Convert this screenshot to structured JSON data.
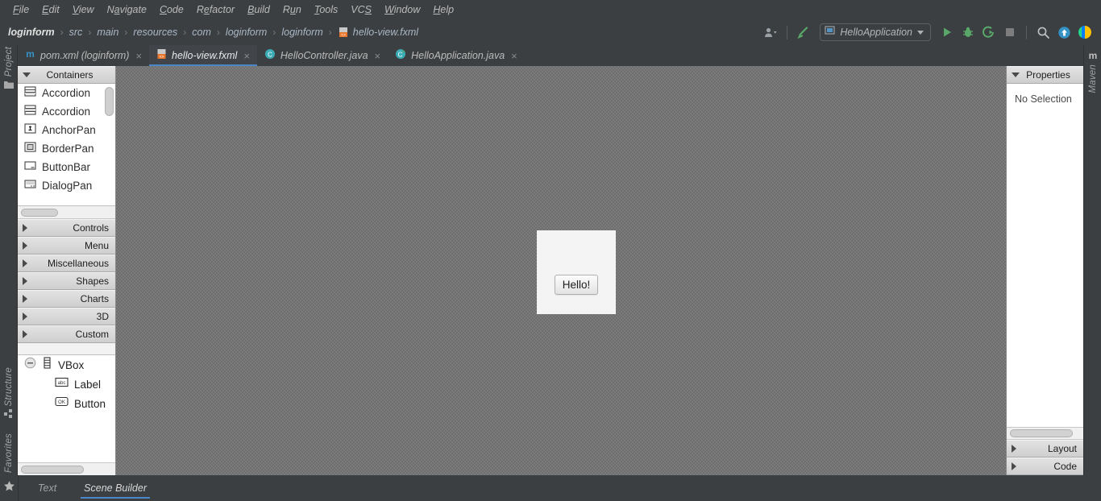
{
  "menu": {
    "items": [
      {
        "label": "File",
        "mnemonic": "F"
      },
      {
        "label": "Edit",
        "mnemonic": "E"
      },
      {
        "label": "View",
        "mnemonic": "V"
      },
      {
        "label": "Navigate",
        "mnemonic": "N"
      },
      {
        "label": "Code",
        "mnemonic": "C"
      },
      {
        "label": "Refactor",
        "mnemonic": "R"
      },
      {
        "label": "Build",
        "mnemonic": "B"
      },
      {
        "label": "Run",
        "mnemonic": "u"
      },
      {
        "label": "Tools",
        "mnemonic": "T"
      },
      {
        "label": "VCS",
        "mnemonic": "S"
      },
      {
        "label": "Window",
        "mnemonic": "W"
      },
      {
        "label": "Help",
        "mnemonic": "H"
      }
    ]
  },
  "breadcrumb": {
    "items": [
      {
        "label": "loginform"
      },
      {
        "label": "src"
      },
      {
        "label": "main"
      },
      {
        "label": "resources"
      },
      {
        "label": "com"
      },
      {
        "label": "loginform"
      },
      {
        "label": "loginform"
      },
      {
        "label": "hello-view.fxml",
        "icon": "fxml-file-icon"
      }
    ],
    "separator": "›"
  },
  "toolbar": {
    "account_icon": "user-account-icon",
    "build_icon": "build-hammer-icon",
    "run_config": {
      "icon": "application-config-icon",
      "label": "HelloApplication",
      "dropdown_icon": "chevron-down-icon"
    },
    "run_icon": "run-play-icon",
    "debug_icon": "debug-bug-icon",
    "run_coverage_icon": "run-with-coverage-icon",
    "stop_icon": "stop-square-icon",
    "search_icon": "search-icon",
    "update_icon": "update-arrow-icon",
    "ide_icon": "intellij-logo-icon"
  },
  "editor_tabs": {
    "close_glyph": "×",
    "tabs": [
      {
        "label": "pom.xml (loginform)",
        "icon": "maven-pom-icon",
        "active": false
      },
      {
        "label": "hello-view.fxml",
        "icon": "fxml-file-icon",
        "active": true
      },
      {
        "label": "HelloController.java",
        "icon": "java-class-icon",
        "active": false
      },
      {
        "label": "HelloApplication.java",
        "icon": "java-class-run-icon",
        "active": false
      }
    ]
  },
  "left_tool_strip": {
    "items": [
      {
        "label": "Project",
        "icon": "folder-icon"
      },
      {
        "label": "Structure",
        "icon": "structure-icon"
      },
      {
        "label": "Favorites",
        "icon": "star-icon"
      }
    ]
  },
  "right_tool_strip": {
    "items": [
      {
        "label": "Maven",
        "icon": "maven-m-icon"
      }
    ]
  },
  "bottom_tabs": {
    "star_icon": "star-icon",
    "tabs": [
      {
        "label": "Text",
        "active": false
      },
      {
        "label": "Scene Builder",
        "active": true
      }
    ]
  },
  "library": {
    "containers": {
      "title": "Containers",
      "expanded": true,
      "items": [
        {
          "label": "Accordion",
          "icon": "accordion-icon"
        },
        {
          "label": "Accordion",
          "icon": "accordion-icon"
        },
        {
          "label": "AnchorPan",
          "icon": "anchorpane-icon"
        },
        {
          "label": "BorderPan",
          "icon": "borderpane-icon"
        },
        {
          "label": "ButtonBar",
          "icon": "buttonbar-icon"
        },
        {
          "label": "DialogPan",
          "icon": "dialogpane-icon"
        }
      ]
    },
    "sections": [
      {
        "label": "Controls",
        "expanded": false
      },
      {
        "label": "Menu",
        "expanded": false
      },
      {
        "label": "Miscellaneous",
        "expanded": false
      },
      {
        "label": "Shapes",
        "expanded": false
      },
      {
        "label": "Charts",
        "expanded": false
      },
      {
        "label": "3D",
        "expanded": false
      },
      {
        "label": "Custom",
        "expanded": false
      }
    ]
  },
  "hierarchy": {
    "nodes": [
      {
        "label": "VBox",
        "icon": "vbox-icon",
        "toggle": "collapse-minus-icon",
        "depth": 0
      },
      {
        "label": "Label",
        "icon": "label-abc-icon",
        "depth": 1
      },
      {
        "label": "Button",
        "icon": "button-ok-icon",
        "depth": 1
      }
    ]
  },
  "canvas": {
    "preview": {
      "button_label": "Hello!"
    }
  },
  "inspector": {
    "properties": {
      "title": "Properties",
      "expanded": true,
      "empty_text": "No Selection"
    },
    "sections": [
      {
        "label": "Layout",
        "expanded": false
      },
      {
        "label": "Code",
        "expanded": false
      }
    ]
  },
  "colors": {
    "chrome": "#3c3f41",
    "accent_blue": "#4a88c7",
    "panel_bg": "#f2f2f2",
    "canvas_gray": "#6f6f6f",
    "run_green": "#59a869",
    "text_light": "#bbbbbb"
  }
}
